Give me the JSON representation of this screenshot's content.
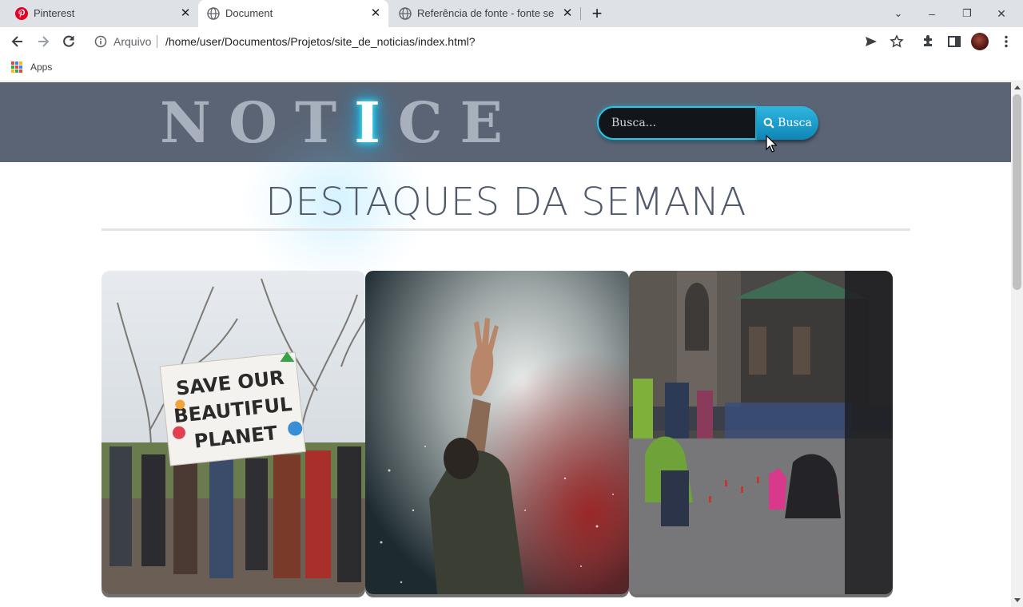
{
  "browser": {
    "tabs": [
      {
        "title": "Pinterest",
        "icon": "pinterest-icon",
        "active": false
      },
      {
        "title": "Document",
        "icon": "globe-icon",
        "active": true
      },
      {
        "title": "Referência de fonte - fonte sem",
        "icon": "globe-icon",
        "active": false
      }
    ],
    "address": {
      "label": "Arquivo",
      "url": "/home/user/Documentos/Projetos/site_de_noticias/index.html?"
    },
    "bookmarks": [
      {
        "label": "Apps"
      }
    ]
  },
  "site": {
    "logo": {
      "before": "NOT",
      "lit": "I",
      "after": "CE"
    },
    "search": {
      "placeholder": "Busca...",
      "button_label": "Busca"
    },
    "section_title": "DESTAQUES DA SEMANA",
    "cards": [
      {
        "image": "protest-save-our-beautiful-planet-banner",
        "banner_text": [
          "SAVE OUR",
          "BEAUTIFUL",
          "PLANET"
        ]
      },
      {
        "image": "raised-hand-in-smoke"
      },
      {
        "image": "candle-vigil-at-cathedral"
      }
    ]
  },
  "colors": {
    "header_bg": "#5a6475",
    "logo_text": "#a9b0bd",
    "logo_glow": "#00d4ff",
    "search_border": "#27c7e8",
    "search_button": "#1a9fcc",
    "title_text": "#505a6b"
  }
}
